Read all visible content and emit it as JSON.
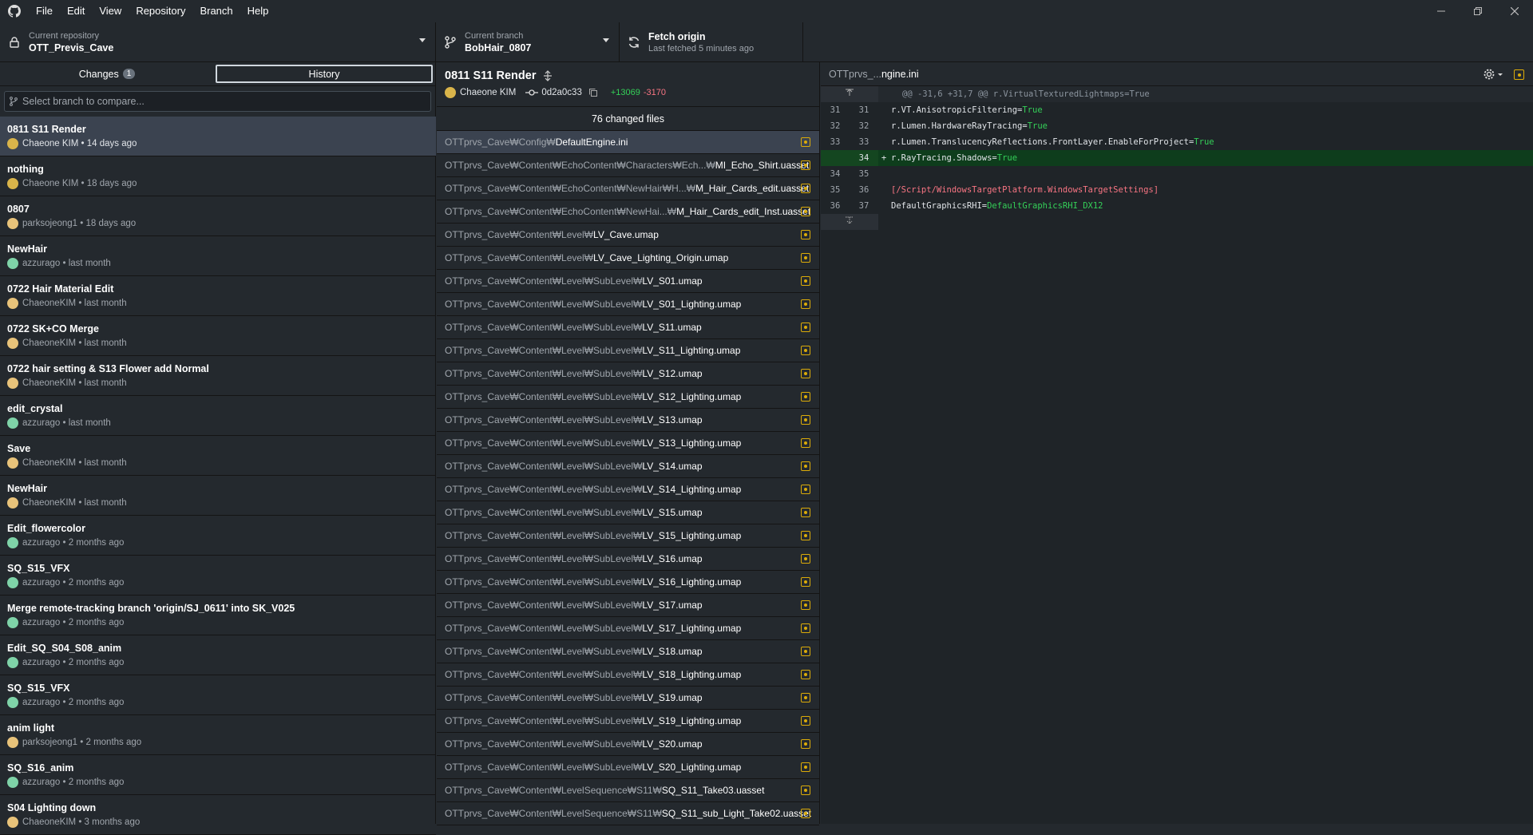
{
  "menu": [
    "File",
    "Edit",
    "View",
    "Repository",
    "Branch",
    "Help"
  ],
  "window_controls": [
    "minimize-icon",
    "restore-icon",
    "close-icon"
  ],
  "toolbar": {
    "repo_label": "Current repository",
    "repo_name": "OTT_Previs_Cave",
    "branch_label": "Current branch",
    "branch_name": "BobHair_0807",
    "fetch_title": "Fetch origin",
    "fetch_sub": "Last fetched 5 minutes ago"
  },
  "tabs": {
    "changes_label": "Changes",
    "changes_count": "1",
    "history_label": "History"
  },
  "compare": {
    "placeholder": "Select branch to compare..."
  },
  "commits": [
    {
      "title": "0811 S11 Render",
      "author": "Chaeone KIM",
      "time": "14 days ago",
      "avatar": "#d9b44a"
    },
    {
      "title": "nothing",
      "author": "Chaeone KIM",
      "time": "18 days ago",
      "avatar": "#d9b44a"
    },
    {
      "title": "0807",
      "author": "parksojeong1",
      "time": "18 days ago",
      "avatar": "#e8c37a"
    },
    {
      "title": "NewHair",
      "author": "azzurago",
      "time": "last month",
      "avatar": "#7fd3a8"
    },
    {
      "title": "0722 Hair Material Edit",
      "author": "ChaeoneKIM",
      "time": "last month",
      "avatar": "#e8c37a"
    },
    {
      "title": "0722 SK+CO Merge",
      "author": "ChaeoneKIM",
      "time": "last month",
      "avatar": "#e8c37a"
    },
    {
      "title": "0722 hair setting & S13 Flower add Normal",
      "author": "ChaeoneKIM",
      "time": "last month",
      "avatar": "#e8c37a"
    },
    {
      "title": "edit_crystal",
      "author": "azzurago",
      "time": "last month",
      "avatar": "#7fd3a8"
    },
    {
      "title": "Save",
      "author": "ChaeoneKIM",
      "time": "last month",
      "avatar": "#e8c37a"
    },
    {
      "title": "NewHair",
      "author": "ChaeoneKIM",
      "time": "last month",
      "avatar": "#e8c37a"
    },
    {
      "title": "Edit_flowercolor",
      "author": "azzurago",
      "time": "2 months ago",
      "avatar": "#7fd3a8"
    },
    {
      "title": "SQ_S15_VFX",
      "author": "azzurago",
      "time": "2 months ago",
      "avatar": "#7fd3a8"
    },
    {
      "title": "Merge remote-tracking branch 'origin/SJ_0611' into SK_V025",
      "author": "azzurago",
      "time": "2 months ago",
      "avatar": "#7fd3a8"
    },
    {
      "title": "Edit_SQ_S04_S08_anim",
      "author": "azzurago",
      "time": "2 months ago",
      "avatar": "#7fd3a8"
    },
    {
      "title": "SQ_S15_VFX",
      "author": "azzurago",
      "time": "2 months ago",
      "avatar": "#7fd3a8"
    },
    {
      "title": "anim light",
      "author": "parksojeong1",
      "time": "2 months ago",
      "avatar": "#e8c37a"
    },
    {
      "title": "SQ_S16_anim",
      "author": "azzurago",
      "time": "2 months ago",
      "avatar": "#7fd3a8"
    },
    {
      "title": "S04 Lighting down",
      "author": "ChaeoneKIM",
      "time": "3 months ago",
      "avatar": "#e8c37a"
    }
  ],
  "commit_detail": {
    "title": "0811 S11 Render",
    "author": "Chaeone KIM",
    "sha": "0d2a0c33",
    "additions": "+13069",
    "deletions": "-3170",
    "changed_files": "76 changed files"
  },
  "files": [
    {
      "path": "OTTprvs_Cave₩Config₩",
      "name": "DefaultEngine.ini"
    },
    {
      "path": "OTTprvs_Cave₩Content₩EchoContent₩Characters₩Ech...₩",
      "name": "MI_Echo_Shirt.uasset"
    },
    {
      "path": "OTTprvs_Cave₩Content₩EchoContent₩NewHair₩H...₩",
      "name": "M_Hair_Cards_edit.uasset"
    },
    {
      "path": "OTTprvs_Cave₩Content₩EchoContent₩NewHai...₩",
      "name": "M_Hair_Cards_edit_Inst.uasset"
    },
    {
      "path": "OTTprvs_Cave₩Content₩Level₩",
      "name": "LV_Cave.umap"
    },
    {
      "path": "OTTprvs_Cave₩Content₩Level₩",
      "name": "LV_Cave_Lighting_Origin.umap"
    },
    {
      "path": "OTTprvs_Cave₩Content₩Level₩SubLevel₩",
      "name": "LV_S01.umap"
    },
    {
      "path": "OTTprvs_Cave₩Content₩Level₩SubLevel₩",
      "name": "LV_S01_Lighting.umap"
    },
    {
      "path": "OTTprvs_Cave₩Content₩Level₩SubLevel₩",
      "name": "LV_S11.umap"
    },
    {
      "path": "OTTprvs_Cave₩Content₩Level₩SubLevel₩",
      "name": "LV_S11_Lighting.umap"
    },
    {
      "path": "OTTprvs_Cave₩Content₩Level₩SubLevel₩",
      "name": "LV_S12.umap"
    },
    {
      "path": "OTTprvs_Cave₩Content₩Level₩SubLevel₩",
      "name": "LV_S12_Lighting.umap"
    },
    {
      "path": "OTTprvs_Cave₩Content₩Level₩SubLevel₩",
      "name": "LV_S13.umap"
    },
    {
      "path": "OTTprvs_Cave₩Content₩Level₩SubLevel₩",
      "name": "LV_S13_Lighting.umap"
    },
    {
      "path": "OTTprvs_Cave₩Content₩Level₩SubLevel₩",
      "name": "LV_S14.umap"
    },
    {
      "path": "OTTprvs_Cave₩Content₩Level₩SubLevel₩",
      "name": "LV_S14_Lighting.umap"
    },
    {
      "path": "OTTprvs_Cave₩Content₩Level₩SubLevel₩",
      "name": "LV_S15.umap"
    },
    {
      "path": "OTTprvs_Cave₩Content₩Level₩SubLevel₩",
      "name": "LV_S15_Lighting.umap"
    },
    {
      "path": "OTTprvs_Cave₩Content₩Level₩SubLevel₩",
      "name": "LV_S16.umap"
    },
    {
      "path": "OTTprvs_Cave₩Content₩Level₩SubLevel₩",
      "name": "LV_S16_Lighting.umap"
    },
    {
      "path": "OTTprvs_Cave₩Content₩Level₩SubLevel₩",
      "name": "LV_S17.umap"
    },
    {
      "path": "OTTprvs_Cave₩Content₩Level₩SubLevel₩",
      "name": "LV_S17_Lighting.umap"
    },
    {
      "path": "OTTprvs_Cave₩Content₩Level₩SubLevel₩",
      "name": "LV_S18.umap"
    },
    {
      "path": "OTTprvs_Cave₩Content₩Level₩SubLevel₩",
      "name": "LV_S18_Lighting.umap"
    },
    {
      "path": "OTTprvs_Cave₩Content₩Level₩SubLevel₩",
      "name": "LV_S19.umap"
    },
    {
      "path": "OTTprvs_Cave₩Content₩Level₩SubLevel₩",
      "name": "LV_S19_Lighting.umap"
    },
    {
      "path": "OTTprvs_Cave₩Content₩Level₩SubLevel₩",
      "name": "LV_S20.umap"
    },
    {
      "path": "OTTprvs_Cave₩Content₩Level₩SubLevel₩",
      "name": "LV_S20_Lighting.umap"
    },
    {
      "path": "OTTprvs_Cave₩Content₩LevelSequence₩S11₩",
      "name": "SQ_S11_Take03.uasset"
    },
    {
      "path": "OTTprvs_Cave₩Content₩LevelSequence₩S11₩",
      "name": "SQ_S11_sub_Light_Take02.uasset"
    }
  ],
  "diff": {
    "file_prefix": "OTTprvs_...",
    "file_name": "ngine.ini",
    "hunk": "@@ -31,6 +31,7 @@ r.VirtualTexturedLightmaps=True",
    "lines": [
      {
        "old": "31",
        "new": "31",
        "type": "ctx",
        "key": "r.VT.AnisotropicFiltering=",
        "val": "True"
      },
      {
        "old": "32",
        "new": "32",
        "type": "ctx",
        "key": "r.Lumen.HardwareRayTracing=",
        "val": "True"
      },
      {
        "old": "33",
        "new": "33",
        "type": "ctx",
        "key": "r.Lumen.TranslucencyReflections.FrontLayer.EnableForProject=",
        "val": "True"
      },
      {
        "old": "",
        "new": "34",
        "type": "add",
        "key": "r.RayTracing.Shadows=",
        "val": "True"
      },
      {
        "old": "34",
        "new": "35",
        "type": "ctx",
        "key": "",
        "val": ""
      },
      {
        "old": "35",
        "new": "36",
        "type": "sec",
        "key": "[/Script/WindowsTargetPlatform.WindowsTargetSettings]",
        "val": ""
      },
      {
        "old": "36",
        "new": "37",
        "type": "ctx",
        "key": "DefaultGraphicsRHI=",
        "val": "DefaultGraphicsRHI_DX12"
      }
    ]
  },
  "colors": {
    "bg": "#24292e",
    "selected": "#3b4350",
    "added": "#34d058",
    "removed": "#f97583",
    "modified": "#dbab09"
  }
}
